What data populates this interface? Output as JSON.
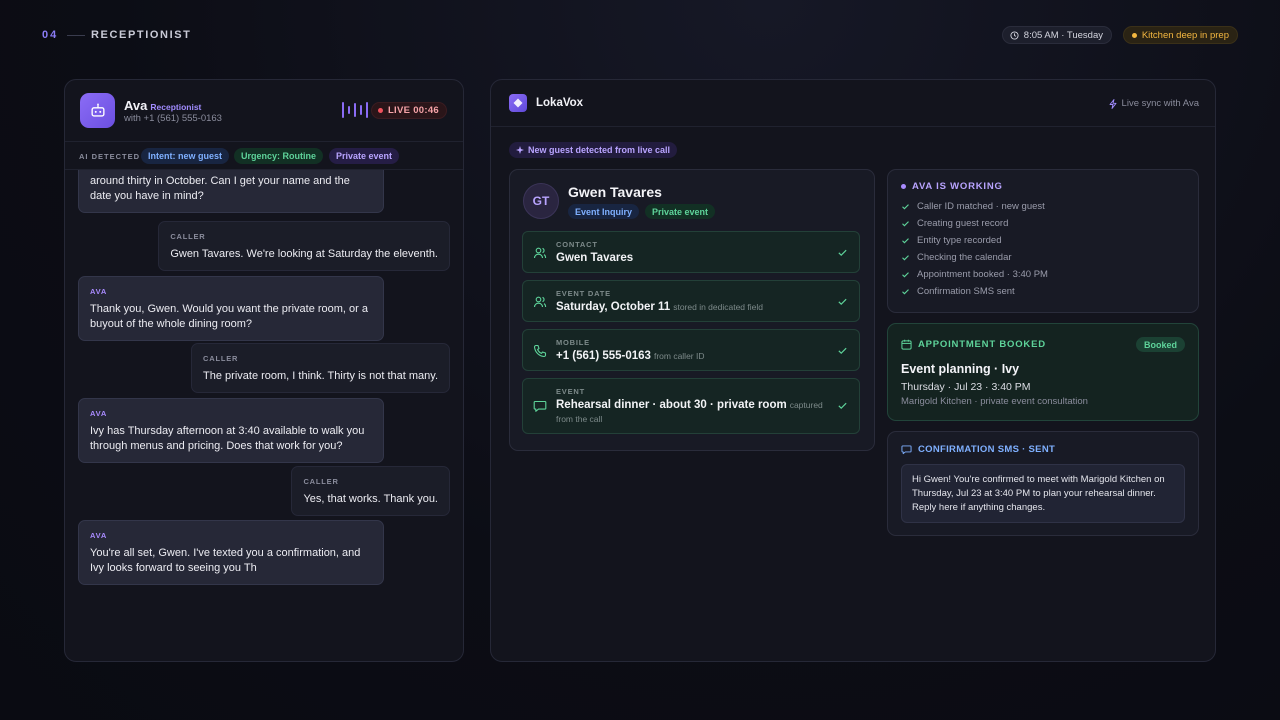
{
  "section": {
    "number": "04",
    "title": "RECEPTIONIST"
  },
  "status": {
    "time": "8:05 AM · Tuesday",
    "kitchen": "Kitchen deep in prep"
  },
  "agent": {
    "name": "Ava",
    "role": "Receptionist",
    "subtitle": "with +1 (561) 555-0163",
    "live_label": "LIVE 00:46"
  },
  "detected": {
    "label": "AI DETECTED",
    "tags": [
      "Intent: new guest",
      "Urgency: Routine",
      "Private event"
    ]
  },
  "chat": [
    {
      "who": "AVA",
      "text": "around thirty in October. Can I get your name and the date you have in mind?"
    },
    {
      "who": "CALLER",
      "text": "Gwen Tavares. We're looking at Saturday the eleventh."
    },
    {
      "who": "AVA",
      "text": "Thank you, Gwen. Would you want the private room, or a buyout of the whole dining room?"
    },
    {
      "who": "CALLER",
      "text": "The private room, I think. Thirty is not that many."
    },
    {
      "who": "AVA",
      "text": "Ivy has Thursday afternoon at 3:40 available to walk you through menus and pricing. Does that work for you?"
    },
    {
      "who": "CALLER",
      "text": "Yes, that works. Thank you."
    },
    {
      "who": "AVA",
      "text": "You're all set, Gwen. I've texted you a confirmation, and Ivy looks forward to seeing you Th"
    }
  ],
  "app": {
    "brand": "LokaVox",
    "sync": "Live sync with Ava"
  },
  "new_guest_badge": "New guest detected from live call",
  "guest": {
    "initials": "GT",
    "name": "Gwen Tavares",
    "tags": [
      "Event Inquiry",
      "Private event"
    ],
    "fields": [
      {
        "label": "CONTACT",
        "value": "Gwen Tavares",
        "note": ""
      },
      {
        "label": "EVENT DATE",
        "value": "Saturday, October 11",
        "note": "stored in dedicated field"
      },
      {
        "label": "MOBILE",
        "value": "+1 (561) 555-0163",
        "note": "from caller ID"
      },
      {
        "label": "EVENT",
        "value": "Rehearsal dinner · about 30 · private room",
        "note": "captured",
        "note2": "from the call"
      }
    ]
  },
  "working": {
    "title": "AVA IS WORKING",
    "steps": [
      "Caller ID matched · new guest",
      "Creating guest record",
      "Entity type recorded",
      "Checking the calendar",
      "Appointment booked · 3:40 PM",
      "Confirmation SMS sent"
    ]
  },
  "appointment": {
    "title": "APPOINTMENT BOOKED",
    "badge": "Booked",
    "main": "Event planning · Ivy",
    "when": "Thursday · Jul 23 · 3:40 PM",
    "where": "Marigold Kitchen · private event consultation"
  },
  "sms": {
    "title": "CONFIRMATION SMS · SENT",
    "body": "Hi Gwen! You're confirmed to meet with Marigold Kitchen on Thursday, Jul 23 at 3:40 PM to plan your rehearsal dinner. Reply here if anything changes."
  },
  "colors": {
    "accent": "#8b6cf6",
    "green": "#5ed39a",
    "blue": "#7fb0ff",
    "amber": "#f4b740",
    "red": "#f0525d"
  }
}
